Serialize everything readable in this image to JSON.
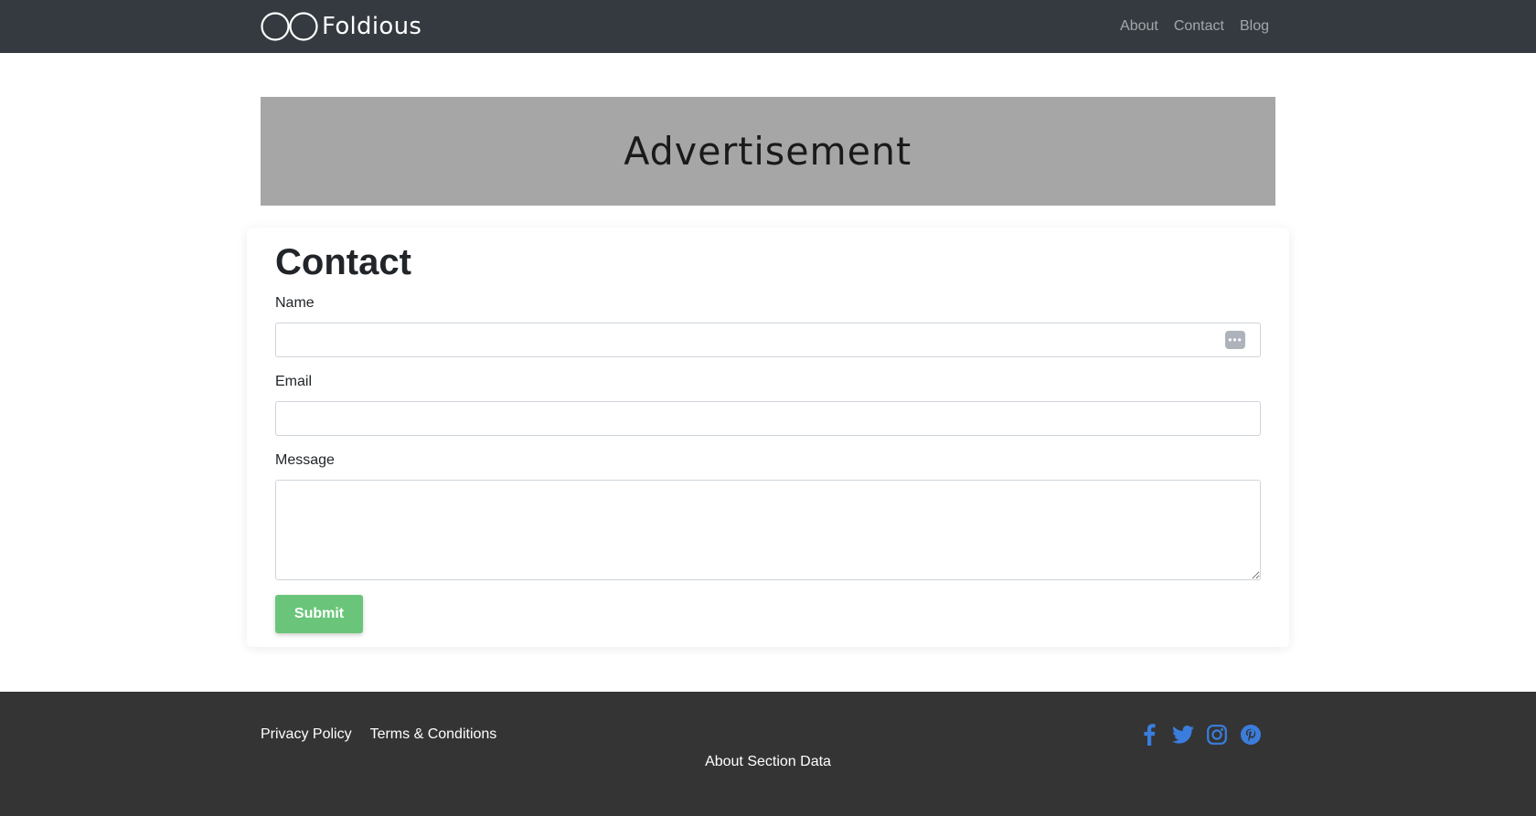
{
  "header": {
    "brand": "Foldious",
    "nav": [
      {
        "label": "About"
      },
      {
        "label": "Contact"
      },
      {
        "label": "Blog"
      }
    ]
  },
  "advertisement": {
    "text": "Advertisement"
  },
  "contact_form": {
    "title": "Contact",
    "fields": {
      "name": {
        "label": "Name",
        "value": ""
      },
      "email": {
        "label": "Email",
        "value": ""
      },
      "message": {
        "label": "Message",
        "value": ""
      }
    },
    "submit_label": "Submit",
    "submit_color": "#6ac57a"
  },
  "footer": {
    "links": [
      {
        "label": "Privacy Policy"
      },
      {
        "label": "Terms & Conditions"
      }
    ],
    "about": "About Section Data",
    "social_icons": [
      "facebook-icon",
      "twitter-icon",
      "instagram-icon",
      "pinterest-icon"
    ],
    "social_color": "#3b7ddd"
  },
  "colors": {
    "navbar": "#343a40",
    "footer": "#343434",
    "ad_background": "#a6a6a6"
  }
}
